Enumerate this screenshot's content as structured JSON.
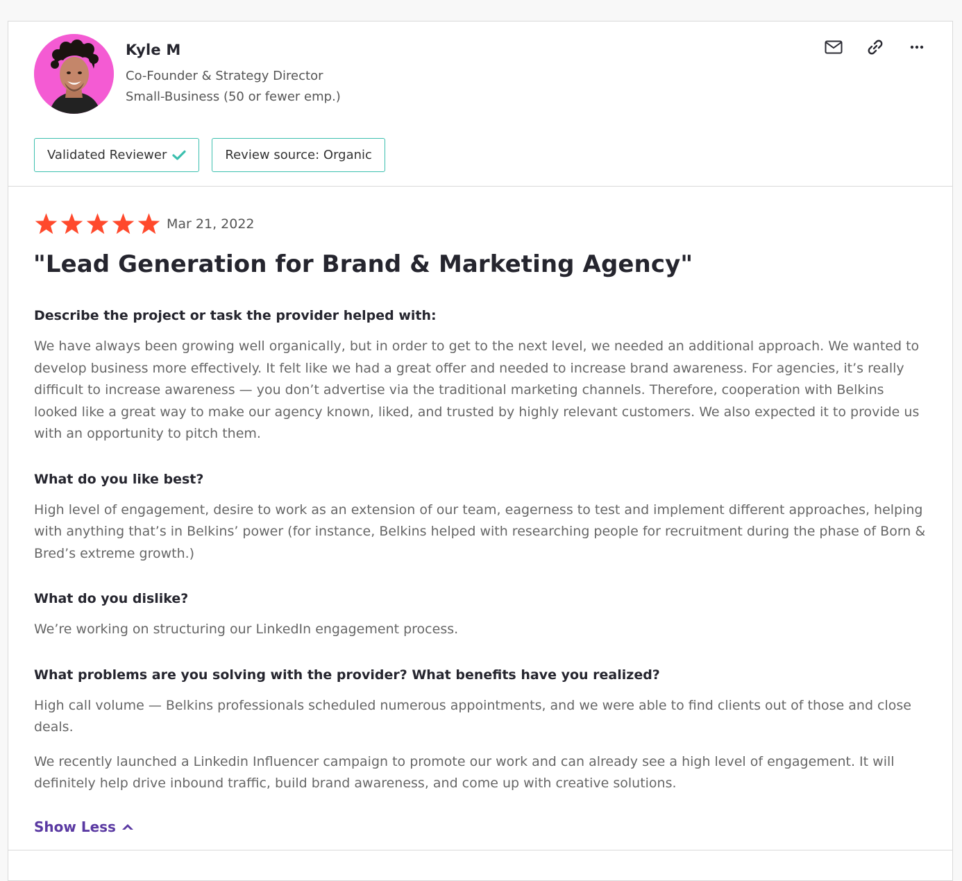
{
  "reviewer": {
    "name": "Kyle M",
    "title": "Co-Founder & Strategy Director",
    "segment": "Small-Business (50 or fewer emp.)"
  },
  "actions": {
    "icons": [
      "mail-icon",
      "link-icon",
      "more-icon"
    ]
  },
  "badges": {
    "validated": "Validated Reviewer",
    "source": "Review source: Organic"
  },
  "review": {
    "rating": 5,
    "rating_max": 5,
    "date": "Mar 21, 2022",
    "title": "\"Lead Generation for Brand & Marketing Agency\"",
    "sections": [
      {
        "question": "Describe the project or task the provider helped with:",
        "answers": [
          "We have always been growing well organically, but in order to get to the next level, we needed an additional approach. We wanted to develop business more effectively. It felt like we had a great offer and needed to increase brand awareness. For agencies, it’s really difficult to increase awareness — you don’t advertise via the traditional marketing channels. Therefore, cooperation with Belkins looked like a great way to make our agency known, liked, and trusted by highly relevant customers. We also expected it to provide us with an opportunity to pitch them."
        ]
      },
      {
        "question": "What do you like best?",
        "answers": [
          "High level of engagement, desire to work as an extension of our team, eagerness to test and implement different approaches, helping with anything that’s in Belkins’ power (for instance, Belkins helped with researching people for recruitment during the phase of Born & Bred’s extreme growth.)"
        ]
      },
      {
        "question": "What do you dislike?",
        "answers": [
          "We’re working on structuring our LinkedIn engagement process."
        ]
      },
      {
        "question": "What problems are you solving with the provider? What benefits have you realized?",
        "answers": [
          "High call volume — Belkins professionals scheduled numerous appointments, and we were able to find clients out of those and close deals.",
          "We recently launched a Linkedin Influencer campaign to promote our work and can already see a high level of engagement. It will definitely help drive inbound traffic, build brand awareness, and come up with creative solutions."
        ]
      }
    ],
    "show_less": "Show Less"
  },
  "colors": {
    "star": "#ff492c",
    "accent": "#3bbfae",
    "link": "#5a39a2",
    "avatar_bg": "#f45bd3"
  }
}
